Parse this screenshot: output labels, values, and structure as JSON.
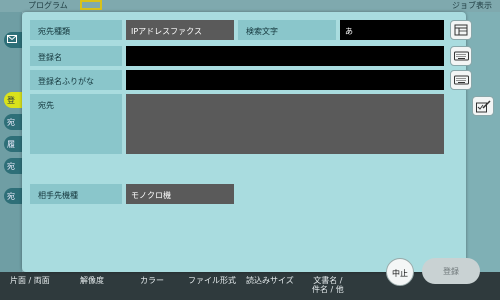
{
  "background": {
    "program_label": "プログラム",
    "job_display_label": "ジョブ表示",
    "left_tabs": [
      "登",
      "宛",
      "履",
      "宛",
      "宛"
    ],
    "bottom_tabs": [
      "片面 / 両面",
      "解像度",
      "カラー",
      "ファイル形式",
      "読込みサイズ",
      "文書名 /\n件名 / 他"
    ]
  },
  "dialog": {
    "destination_type": {
      "label": "宛先種類",
      "value": "IPアドレスファクス"
    },
    "search_char": {
      "label": "検索文字",
      "value": "あ"
    },
    "reg_name": {
      "label": "登録名",
      "value": ""
    },
    "reg_name_kana": {
      "label": "登録名ふりがな",
      "value": ""
    },
    "destination": {
      "label": "宛先",
      "value": ""
    },
    "partner_model": {
      "label": "相手先機種",
      "value": "モノクロ機"
    },
    "cancel_label": "中止",
    "register_label": "登録"
  },
  "colors": {
    "dialog_bg": "#a9dcdf",
    "label_bg": "#8ac6cb",
    "field_black": "#000000",
    "field_gray": "#5a5a5a",
    "highlight_yellow": "#d8c21a"
  },
  "icons": {
    "list": "list-icon",
    "keyboard": "keyboard-icon",
    "edit": "edit-icon"
  }
}
